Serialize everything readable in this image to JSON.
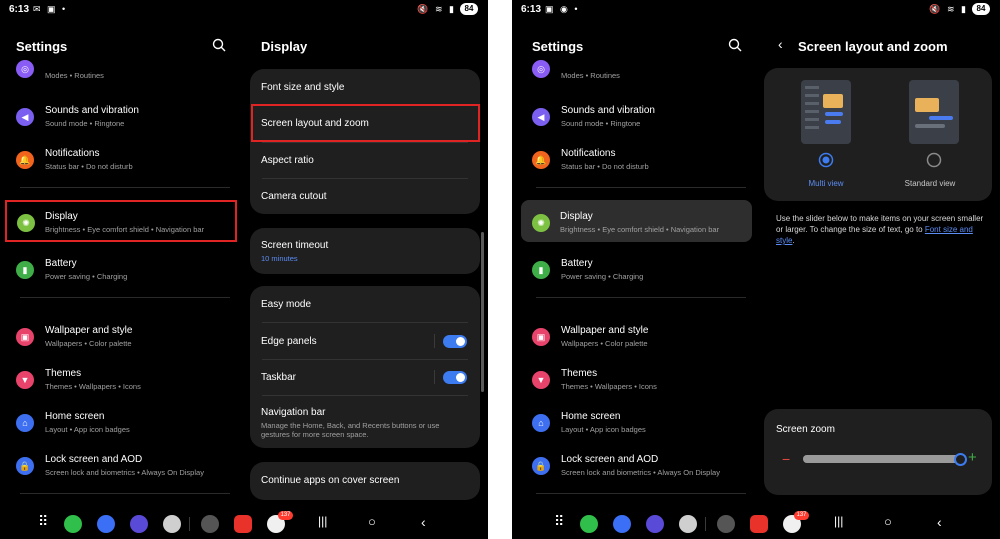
{
  "status": {
    "time": "6:13",
    "battery": "84"
  },
  "left": {
    "settings_title": "Settings",
    "items": [
      {
        "title": "",
        "sub": "Modes • Routines"
      },
      {
        "title": "Sounds and vibration",
        "sub": "Sound mode • Ringtone"
      },
      {
        "title": "Notifications",
        "sub": "Status bar • Do not disturb"
      },
      {
        "title": "Display",
        "sub": "Brightness • Eye comfort shield • Navigation bar"
      },
      {
        "title": "Battery",
        "sub": "Power saving • Charging"
      },
      {
        "title": "Wallpaper and style",
        "sub": "Wallpapers • Color palette"
      },
      {
        "title": "Themes",
        "sub": "Themes • Wallpapers • Icons"
      },
      {
        "title": "Home screen",
        "sub": "Layout • App icon badges"
      },
      {
        "title": "Lock screen and AOD",
        "sub": "Screen lock and biometrics • Always On Display"
      }
    ],
    "display_title": "Display",
    "display_rows": {
      "font": "Font size and style",
      "layout": "Screen layout and zoom",
      "aspect": "Aspect ratio",
      "cutout": "Camera cutout",
      "timeout": "Screen timeout",
      "timeout_sub": "10 minutes",
      "easy": "Easy mode",
      "edge": "Edge panels",
      "taskbar": "Taskbar",
      "navbar": "Navigation bar",
      "navbar_sub": "Manage the Home, Back, and Recents buttons or use gestures for more screen space.",
      "cover": "Continue apps on cover screen"
    }
  },
  "right": {
    "settings_title": "Settings",
    "layout_title": "Screen layout and zoom",
    "multi_view": "Multi view",
    "standard_view": "Standard view",
    "description_a": "Use the slider below to make items on your screen smaller or larger. To change the size of text, go to ",
    "description_link": "Font size and style",
    "description_b": ".",
    "zoom_title": "Screen zoom",
    "zoom_level": 0.98
  },
  "badge": "137",
  "colors": {
    "accent": "#3d7cf0",
    "highlight": "#e02424"
  }
}
